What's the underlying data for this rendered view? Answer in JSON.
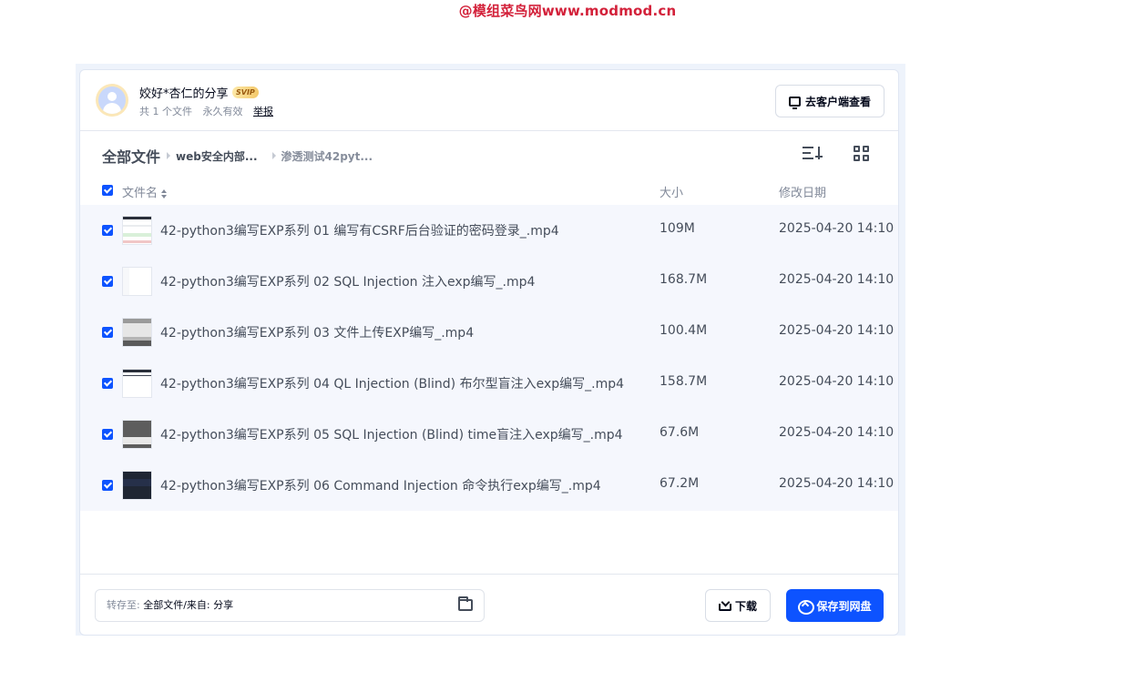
{
  "watermark": "@模组菜鸟网www.modmod.cn",
  "share": {
    "title": "姣好*杏仁的分享",
    "badge": "SVIP",
    "file_count": "共 1 个文件",
    "validity": "永久有效",
    "report": "举报",
    "client_button": "去客户端查看"
  },
  "breadcrumb": {
    "root": "全部文件",
    "items": [
      "web安全内部...",
      "渗透测试42pyt..."
    ]
  },
  "columns": {
    "name": "文件名",
    "size": "大小",
    "modified": "修改日期"
  },
  "files": [
    {
      "name": "42-python3编写EXP系列 01 编写有CSRF后台验证的密码登录_.mp4",
      "size": "109M",
      "date": "2025-04-20 14:10",
      "checked": true
    },
    {
      "name": "42-python3编写EXP系列 02 SQL Injection 注入exp编写_.mp4",
      "size": "168.7M",
      "date": "2025-04-20 14:10",
      "checked": true
    },
    {
      "name": "42-python3编写EXP系列 03 文件上传EXP编写_.mp4",
      "size": "100.4M",
      "date": "2025-04-20 14:10",
      "checked": true
    },
    {
      "name": "42-python3编写EXP系列 04 QL Injection (Blind) 布尔型盲注入exp编写_.mp4",
      "size": "158.7M",
      "date": "2025-04-20 14:10",
      "checked": true
    },
    {
      "name": "42-python3编写EXP系列 05 SQL Injection (Blind) time盲注入exp编写_.mp4",
      "size": "67.6M",
      "date": "2025-04-20 14:10",
      "checked": true
    },
    {
      "name": "42-python3编写EXP系列 06 Command Injection 命令执行exp编写_.mp4",
      "size": "67.2M",
      "date": "2025-04-20 14:10",
      "checked": true
    }
  ],
  "footer": {
    "save_to_label": "转存至:",
    "save_to_value": "全部文件/来自: 分享",
    "download": "下载",
    "save": "保存到网盘"
  },
  "colors": {
    "accent": "#0d53ff",
    "row_bg": "#f5f7fd",
    "watermark": "#d3213a"
  }
}
